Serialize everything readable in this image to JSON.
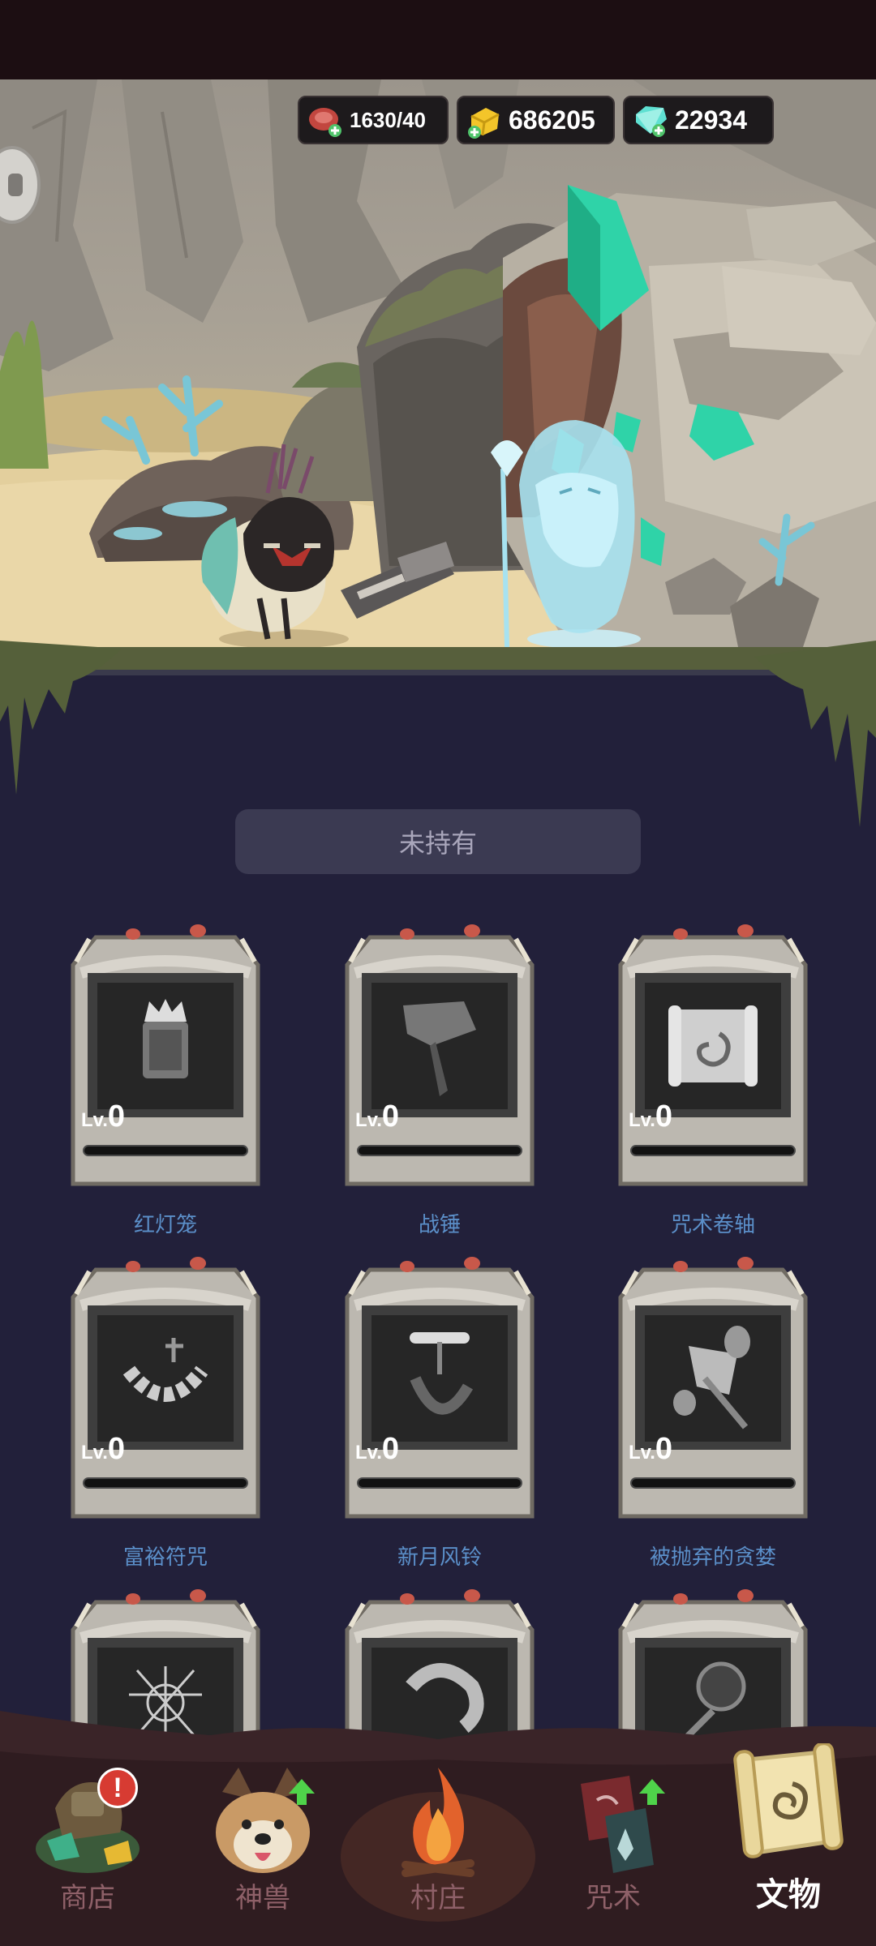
{
  "resources": {
    "meat": "1630/40",
    "gold": "686205",
    "gem": "22934"
  },
  "panel": {
    "filter_label": "未持有"
  },
  "relics": [
    {
      "icon": "lantern-icon",
      "level_prefix": "Lv.",
      "level": "0",
      "name": "红灯笼"
    },
    {
      "icon": "war-hammer-icon",
      "level_prefix": "Lv.",
      "level": "0",
      "name": "战锤"
    },
    {
      "icon": "scroll-icon",
      "level_prefix": "Lv.",
      "level": "0",
      "name": "咒术卷轴"
    },
    {
      "icon": "charm-necklace-icon",
      "level_prefix": "Lv.",
      "level": "0",
      "name": "富裕符咒"
    },
    {
      "icon": "wind-chime-icon",
      "level_prefix": "Lv.",
      "level": "0",
      "name": "新月风铃"
    },
    {
      "icon": "ghost-axe-icon",
      "level_prefix": "Lv.",
      "level": "0",
      "name": "被抛弃的贪婪"
    },
    {
      "icon": "spider-web-icon",
      "level_prefix": "",
      "level": "",
      "name": ""
    },
    {
      "icon": "horn-ring-icon",
      "level_prefix": "",
      "level": "",
      "name": ""
    },
    {
      "icon": "crystal-staff-icon",
      "level_prefix": "",
      "level": "",
      "name": ""
    }
  ],
  "nav": {
    "shop": "商店",
    "beast": "神兽",
    "village": "村庄",
    "spell": "咒术",
    "relic": "文物"
  },
  "colors": {
    "panel_bg": "#22203a",
    "relic_name": "#5b8fc9",
    "nav_inactive": "#8e6068",
    "nav_active": "#ffffff",
    "crystal": "#2fd3a8"
  }
}
